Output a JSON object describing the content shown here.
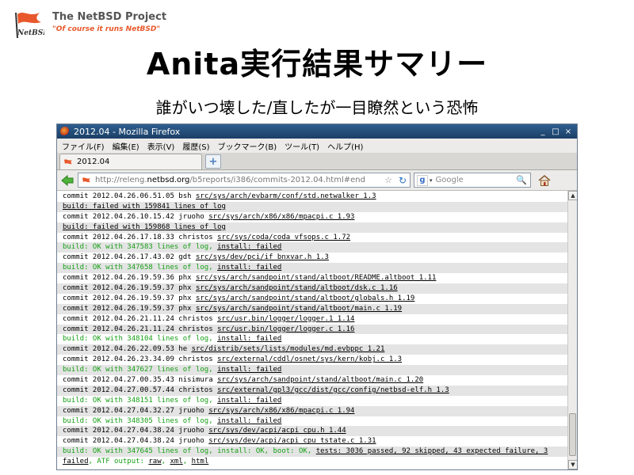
{
  "header": {
    "project": "The NetBSD Project",
    "tagline": "\"Of course it runs NetBSD\"",
    "title": "Anita実行結果サマリー",
    "subtitle": "誰がいつ壊した/直したが一目瞭然という恐怖"
  },
  "browser": {
    "window_title": "2012.04 - Mozilla Firefox",
    "window_buttons": [
      "_",
      "□",
      "×"
    ],
    "menu": [
      "ファイル(F)",
      "編集(E)",
      "表示(V)",
      "履歴(S)",
      "ブックマーク(B)",
      "ツール(T)",
      "ヘルプ(H)"
    ],
    "tab_label": "2012.04",
    "new_tab": "+",
    "url_prefix": "http://releng.",
    "url_host": "netbsd.org",
    "url_path": "/b5reports/i386/commits-2012.04.html#end",
    "star": "☆",
    "reload": "↻",
    "search_placeholder": "Google",
    "search_engine_letter": "g",
    "magnifier": "🔍",
    "scroll_up": "▲",
    "scroll_down": "▼"
  },
  "colors": {
    "fail": "#e81313",
    "ok": "#16a016",
    "title_bar": "#1b3f66",
    "brand_orange": "#e8582c"
  },
  "log": [
    {
      "type": "commit",
      "text": "commit 2012.04.26.06.51.05 bsh ",
      "link": "src/sys/arch/evbarm/conf/std.netwalker 1.3"
    },
    {
      "type": "fail",
      "text": "build: failed with 159841 lines of log"
    },
    {
      "type": "commit",
      "text": "commit 2012.04.26.10.15.42 jruoho ",
      "link": "src/sys/arch/x86/x86/mpacpi.c 1.93"
    },
    {
      "type": "fail",
      "text": "build: failed with 159868 lines of log"
    },
    {
      "type": "commit",
      "text": "commit 2012.04.26.17.18.33 christos ",
      "link": "src/sys/coda/coda_vfsops.c 1.72"
    },
    {
      "type": "okfail",
      "text": "build: OK with 347583 lines of log, ",
      "fail": "install: failed"
    },
    {
      "type": "commit",
      "text": "commit 2012.04.26.17.43.02 gdt ",
      "link": "src/sys/dev/pci/if_bnxvar.h 1.3"
    },
    {
      "type": "okfail",
      "text": "build: OK with 347658 lines of log, ",
      "fail": "install: failed"
    },
    {
      "type": "commit",
      "text": "commit 2012.04.26.19.59.36 phx ",
      "link": "src/sys/arch/sandpoint/stand/altboot/README.altboot 1.11"
    },
    {
      "type": "commit",
      "text": "commit 2012.04.26.19.59.37 phx ",
      "link": "src/sys/arch/sandpoint/stand/altboot/dsk.c 1.16"
    },
    {
      "type": "commit",
      "text": "commit 2012.04.26.19.59.37 phx ",
      "link": "src/sys/arch/sandpoint/stand/altboot/globals.h 1.19"
    },
    {
      "type": "commit",
      "text": "commit 2012.04.26.19.59.37 phx ",
      "link": "src/sys/arch/sandpoint/stand/altboot/main.c 1.19"
    },
    {
      "type": "commit",
      "text": "commit 2012.04.26.21.11.24 christos ",
      "link": "src/usr.bin/logger/logger.1 1.14"
    },
    {
      "type": "commit",
      "text": "commit 2012.04.26.21.11.24 christos ",
      "link": "src/usr.bin/logger/logger.c 1.16"
    },
    {
      "type": "okfail",
      "text": "build: OK with 348104 lines of log, ",
      "fail": "install: failed"
    },
    {
      "type": "commit",
      "text": "commit 2012.04.26.22.09.53 he ",
      "link": "src/distrib/sets/lists/modules/md.evbppc 1.21"
    },
    {
      "type": "commit",
      "text": "commit 2012.04.26.23.34.09 christos ",
      "link": "src/external/cddl/osnet/sys/kern/kobj.c 1.3"
    },
    {
      "type": "okfail",
      "text": "build: OK with 347627 lines of log, ",
      "fail": "install: failed"
    },
    {
      "type": "commit",
      "text": "commit 2012.04.27.00.35.43 nisimura ",
      "link": "src/sys/arch/sandpoint/stand/altboot/main.c 1.20"
    },
    {
      "type": "commit",
      "text": "commit 2012.04.27.00.57.44 christos ",
      "link": "src/external/gpl3/gcc/dist/gcc/config/netbsd-elf.h 1.3"
    },
    {
      "type": "okfail",
      "text": "build: OK with 348151 lines of log, ",
      "fail": "install: failed"
    },
    {
      "type": "commit",
      "text": "commit 2012.04.27.04.32.27 jruoho ",
      "link": "src/sys/arch/x86/x86/mpacpi.c 1.94"
    },
    {
      "type": "okfail",
      "text": "build: OK with 348305 lines of log, ",
      "fail": "install: failed"
    },
    {
      "type": "commit",
      "text": "commit 2012.04.27.04.38.24 jruoho ",
      "link": "src/sys/dev/acpi/acpi_cpu.h 1.44"
    },
    {
      "type": "commit",
      "text": "commit 2012.04.27.04.38.24 jruoho ",
      "link": "src/sys/dev/acpi/acpi_cpu_tstate.c 1.31"
    },
    {
      "type": "okboot",
      "text": "build: OK with 347645 lines of log, install: OK, boot: OK, ",
      "fail": "tests: 3036 passed, 92 skipped, 43 expected failure, 3"
    },
    {
      "type": "failcont",
      "fail": "failed",
      "text": ", ATF output: ",
      "links": [
        "raw",
        ", ",
        "xml",
        ", ",
        "html"
      ]
    }
  ]
}
